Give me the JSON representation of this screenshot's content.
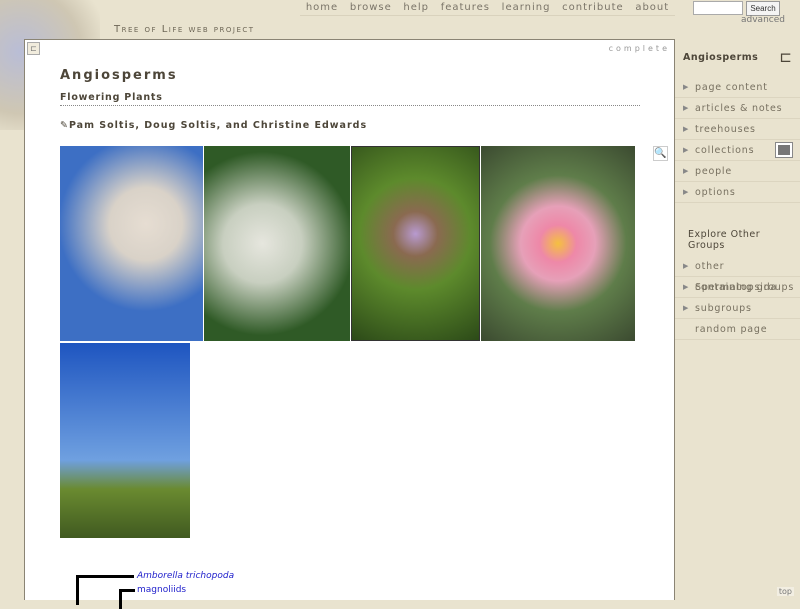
{
  "header": {
    "nav": [
      "home",
      "browse",
      "help",
      "features",
      "learning",
      "contribute",
      "about"
    ],
    "brand": "Tree of Life web project",
    "search_button": "Search",
    "search_value": "",
    "advanced": "advanced"
  },
  "main": {
    "status": "complete",
    "title": "Angiosperms",
    "subtitle": "Flowering Plants",
    "authors": "Pam Soltis, Doug Soltis, and Christine Edwards",
    "images": [
      {
        "name": "magnolia blossoms",
        "colors": [
          "#3d6fc4",
          "#d9d2c8"
        ]
      },
      {
        "name": "yarrow white flowers",
        "colors": [
          "#2f5a26",
          "#e6e6de"
        ]
      },
      {
        "name": "bee orchid",
        "colors": [
          "#5d8a2c",
          "#b89ad0"
        ]
      },
      {
        "name": "water lily",
        "colors": [
          "#5f7d4a",
          "#ee88a8"
        ]
      },
      {
        "name": "acacia tree",
        "colors": [
          "#1e55c0",
          "#6a8a30"
        ]
      }
    ],
    "tree": [
      "Amborella trichopoda",
      "magnoliids"
    ]
  },
  "sidebar": {
    "title": "Angiosperms",
    "items": [
      "page content",
      "articles & notes",
      "treehouses",
      "collections",
      "people",
      "options"
    ],
    "explore_title": "Explore Other Groups",
    "explore_items": [
      "other Spermatopsida",
      "containing groups",
      "subgroups",
      "random page"
    ],
    "top": "top"
  }
}
